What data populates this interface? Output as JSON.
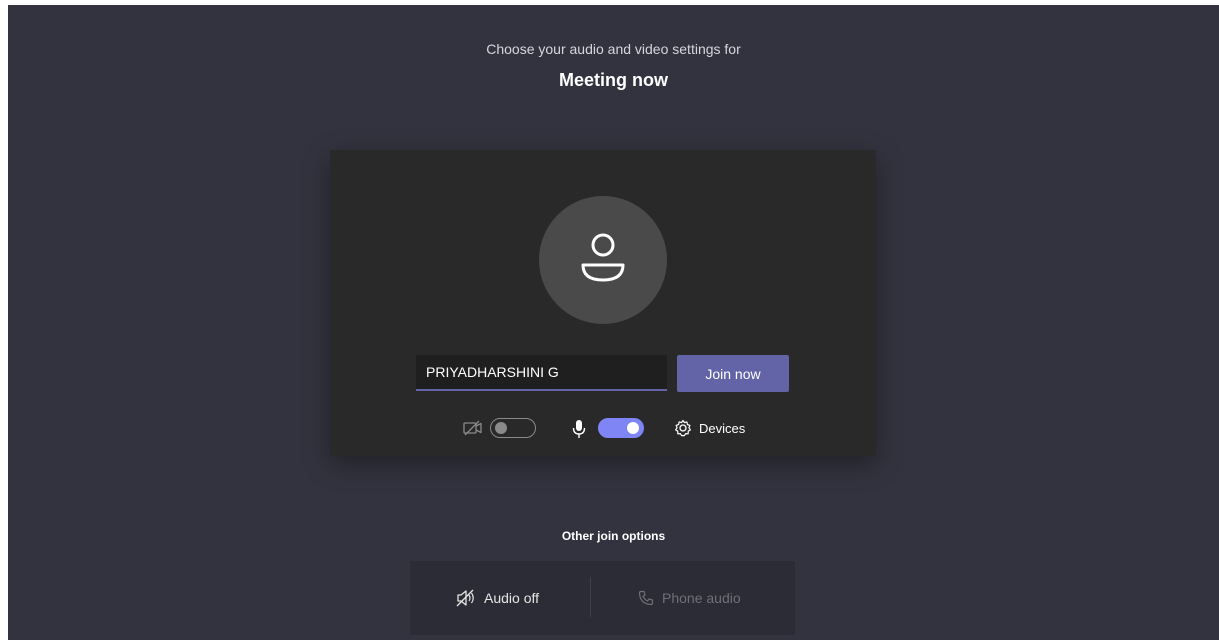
{
  "header": {
    "subtitle": "Choose your audio and video settings for",
    "meeting_title": "Meeting now"
  },
  "prejoin": {
    "avatar_icon": "person-icon",
    "name_value": "PRIYADHARSHINI G",
    "join_label": "Join now",
    "camera": {
      "icon": "camera-off-icon",
      "state": "off"
    },
    "microphone": {
      "icon": "microphone-icon",
      "state": "on"
    },
    "devices_label": "Devices",
    "devices_icon": "gear-icon"
  },
  "other_options": {
    "label": "Other join options",
    "audio_off_label": "Audio off",
    "audio_off_icon": "speaker-off-icon",
    "phone_audio_label": "Phone audio",
    "phone_audio_icon": "phone-icon"
  },
  "colors": {
    "background": "#33333f",
    "card": "#292929",
    "accent": "#6264a7",
    "toggle_on": "#7f85f5"
  }
}
